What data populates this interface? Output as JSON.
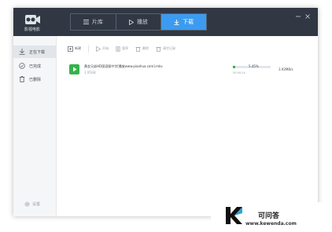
{
  "app": {
    "logo_text": "影视电影"
  },
  "nav": {
    "tabs": [
      {
        "label": "片库",
        "icon": "list-icon"
      },
      {
        "label": "播放",
        "icon": "play-icon"
      },
      {
        "label": "下载",
        "icon": "download-icon"
      }
    ],
    "active_index": 2
  },
  "window_controls": {
    "minimize": "minimize-icon",
    "close": "close-icon"
  },
  "sidebar": {
    "items": [
      {
        "label": "正在下载",
        "icon": "download-icon"
      },
      {
        "label": "已完成",
        "icon": "check-circle-icon"
      },
      {
        "label": "已删除",
        "icon": "trash-icon"
      }
    ],
    "active_index": 0,
    "settings_label": "设置"
  },
  "toolbar": {
    "new_label": "新建",
    "start_label": "开始",
    "pause_label": "暂停",
    "delete_label": "删除",
    "clear_label": "清空记录"
  },
  "download": {
    "file_name": "黄金兄弟HD国语版中字[播放www.piaohua.com].mkv",
    "file_size": "1.95GB",
    "progress": 0.0545,
    "percent_text": "5.45%",
    "elapsed": "00:00:14",
    "speed": "3.92MB/s"
  },
  "colors": {
    "titlebar": "#313843",
    "accent": "#3c9bf0",
    "progress": "#35b34a"
  },
  "watermark": {
    "name": "可问答",
    "url": "www.kewenda.com"
  }
}
